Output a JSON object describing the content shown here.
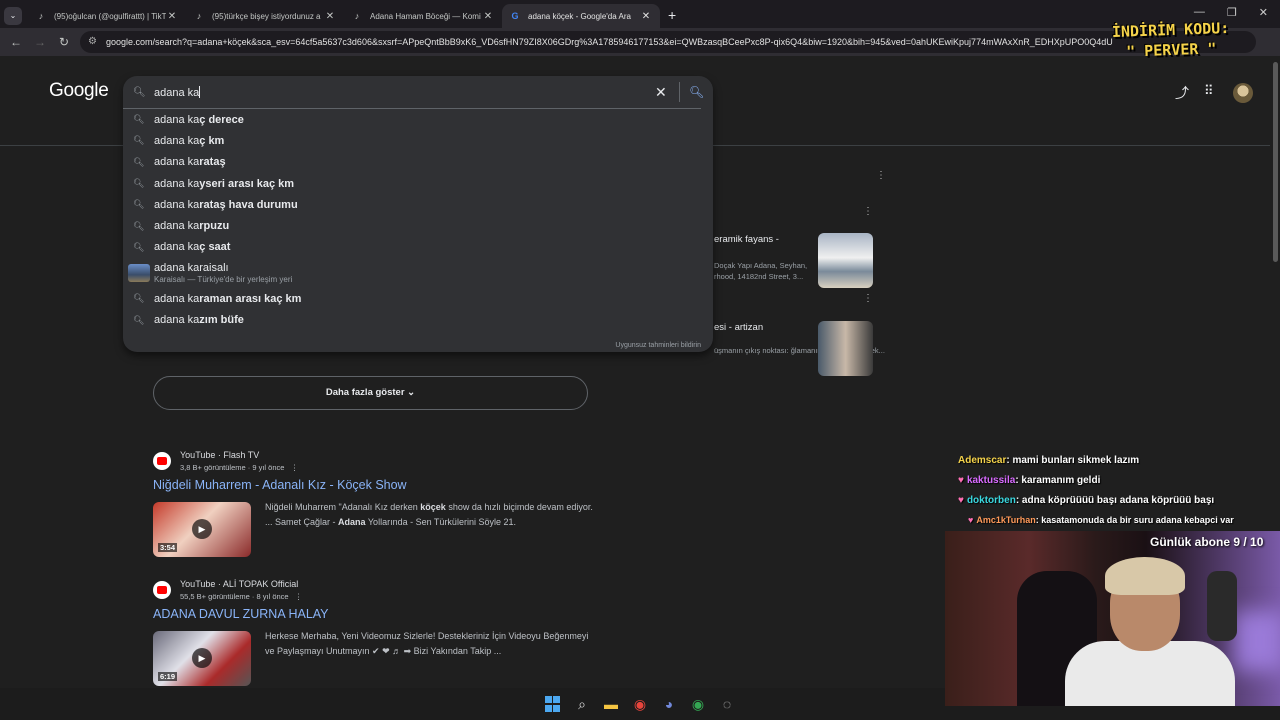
{
  "browser": {
    "tabs": [
      {
        "title": "(95)oğulcan (@ogulfirattt) | TikT",
        "icon": "tiktok-icon",
        "active": false
      },
      {
        "title": "(95)türkçe bişey istiyordunuz a",
        "icon": "tiktok-icon",
        "active": false
      },
      {
        "title": "Adana Hamam Böceği — Komi",
        "icon": "tiktok-icon",
        "active": false
      },
      {
        "title": "adana köçek - Google'da Ara",
        "icon": "google-icon",
        "active": true
      }
    ],
    "url": "google.com/search?q=adana+köçek&sca_esv=64cf5a5637c3d606&sxsrf=APpeQntBbB9xK6_VD6sfHN79ZI8X06GDrg%3A1785946177153&ei=QWBzasqBCeePxc8P-qix6Q4&biw=1920&bih=945&ved=0ahUKEwiKpuj774mWAxXnR_EDHXpUPO0Q4dU"
  },
  "overlay": {
    "promo_line1": "İNDİRİM KODU:",
    "promo_line2": "\" PERVER \"",
    "daily_subs": "Günlük abone 9 / 10",
    "chat": [
      {
        "user": "Ademscar",
        "user_color": "#f5d34a",
        "message": ": mami bunları sikmek lazım",
        "badge": false
      },
      {
        "user": "kaktussila",
        "user_color": "#d86bff",
        "message": ": karamanım geldi",
        "badge": true
      },
      {
        "user": "doktorben",
        "user_color": "#3ad8e0",
        "message": ": adna köprüüüü başı adana köprüüü başı",
        "badge": true
      },
      {
        "user": "Amc1kTurhan",
        "user_color": "#ff9a5a",
        "message": ": kasatamonuda da bir suru adana kebapci var",
        "badge": true
      }
    ]
  },
  "google": {
    "logo": "Google",
    "query": "adana ka",
    "suggestions": [
      {
        "prefix": "adana ka",
        "bold": "ç derece",
        "sub": ""
      },
      {
        "prefix": "adana ka",
        "bold": "ç km",
        "sub": ""
      },
      {
        "prefix": "adana ka",
        "bold": "rataş",
        "sub": ""
      },
      {
        "prefix": "adana ka",
        "bold": "yseri arası kaç km",
        "sub": ""
      },
      {
        "prefix": "adana ka",
        "bold": "rataş hava durumu",
        "sub": ""
      },
      {
        "prefix": "adana ka",
        "bold": "rpuzu",
        "sub": ""
      },
      {
        "prefix": "adana ka",
        "bold": "ç saat",
        "sub": ""
      },
      {
        "prefix": "adana karaisalı",
        "bold": "",
        "sub": "Karaisalı — Türkiye'de bir yerleşim yeri"
      },
      {
        "prefix": "adana ka",
        "bold": "raman arası kaç km",
        "sub": ""
      },
      {
        "prefix": "adana ka",
        "bold": "zım büfe",
        "sub": ""
      }
    ],
    "report_link": "Uygunsuz tahminleri bildirin",
    "side_card": {
      "title1": "eramik fayans -",
      "snippet1": "Doçak Yapı Adana, Seyhan, rhood, 14182nd Street, 3...",
      "title2": "esi - artizan",
      "snippet2": "üşmanın çıkış noktası: ğlamanın dans edip, erkek..."
    },
    "more_button": "Daha fazla göster",
    "results": [
      {
        "source": "YouTube · Flash TV",
        "meta": "3,8 B+ görüntüleme · 9 yıl önce",
        "title": "Niğdeli Muharrem - Adanalı Kız - Köçek Show",
        "duration": "3:54",
        "desc_a": "Niğdeli Muharrem \"Adanalı Kız derken ",
        "desc_b": "köçek",
        "desc_c": " show da hızlı biçimde devam ediyor. ... Samet Çağlar - ",
        "desc_d": "Adana",
        "desc_e": " Yollarında - Sen Türkülerini Söyle 21.",
        "thumb_color": "#c43a2a"
      },
      {
        "source": "YouTube · ALİ TOPAK Official",
        "meta": "55,5 B+ görüntüleme · 8 yıl önce",
        "title": "ADANA DAVUL ZURNA HALAY",
        "duration": "6:19",
        "desc_a": "Herkese Merhaba, Yeni Videomuz Sizlerle! Destekleriniz İçin Videoyu Beğenmeyi ve Paylaşmayı Unutmayın ✔ ❤ ♬ ➡ Bizi Yakından Takip ...",
        "desc_b": "",
        "desc_c": "",
        "desc_d": "",
        "desc_e": "",
        "thumb_color": "#8a8a9a"
      }
    ]
  }
}
